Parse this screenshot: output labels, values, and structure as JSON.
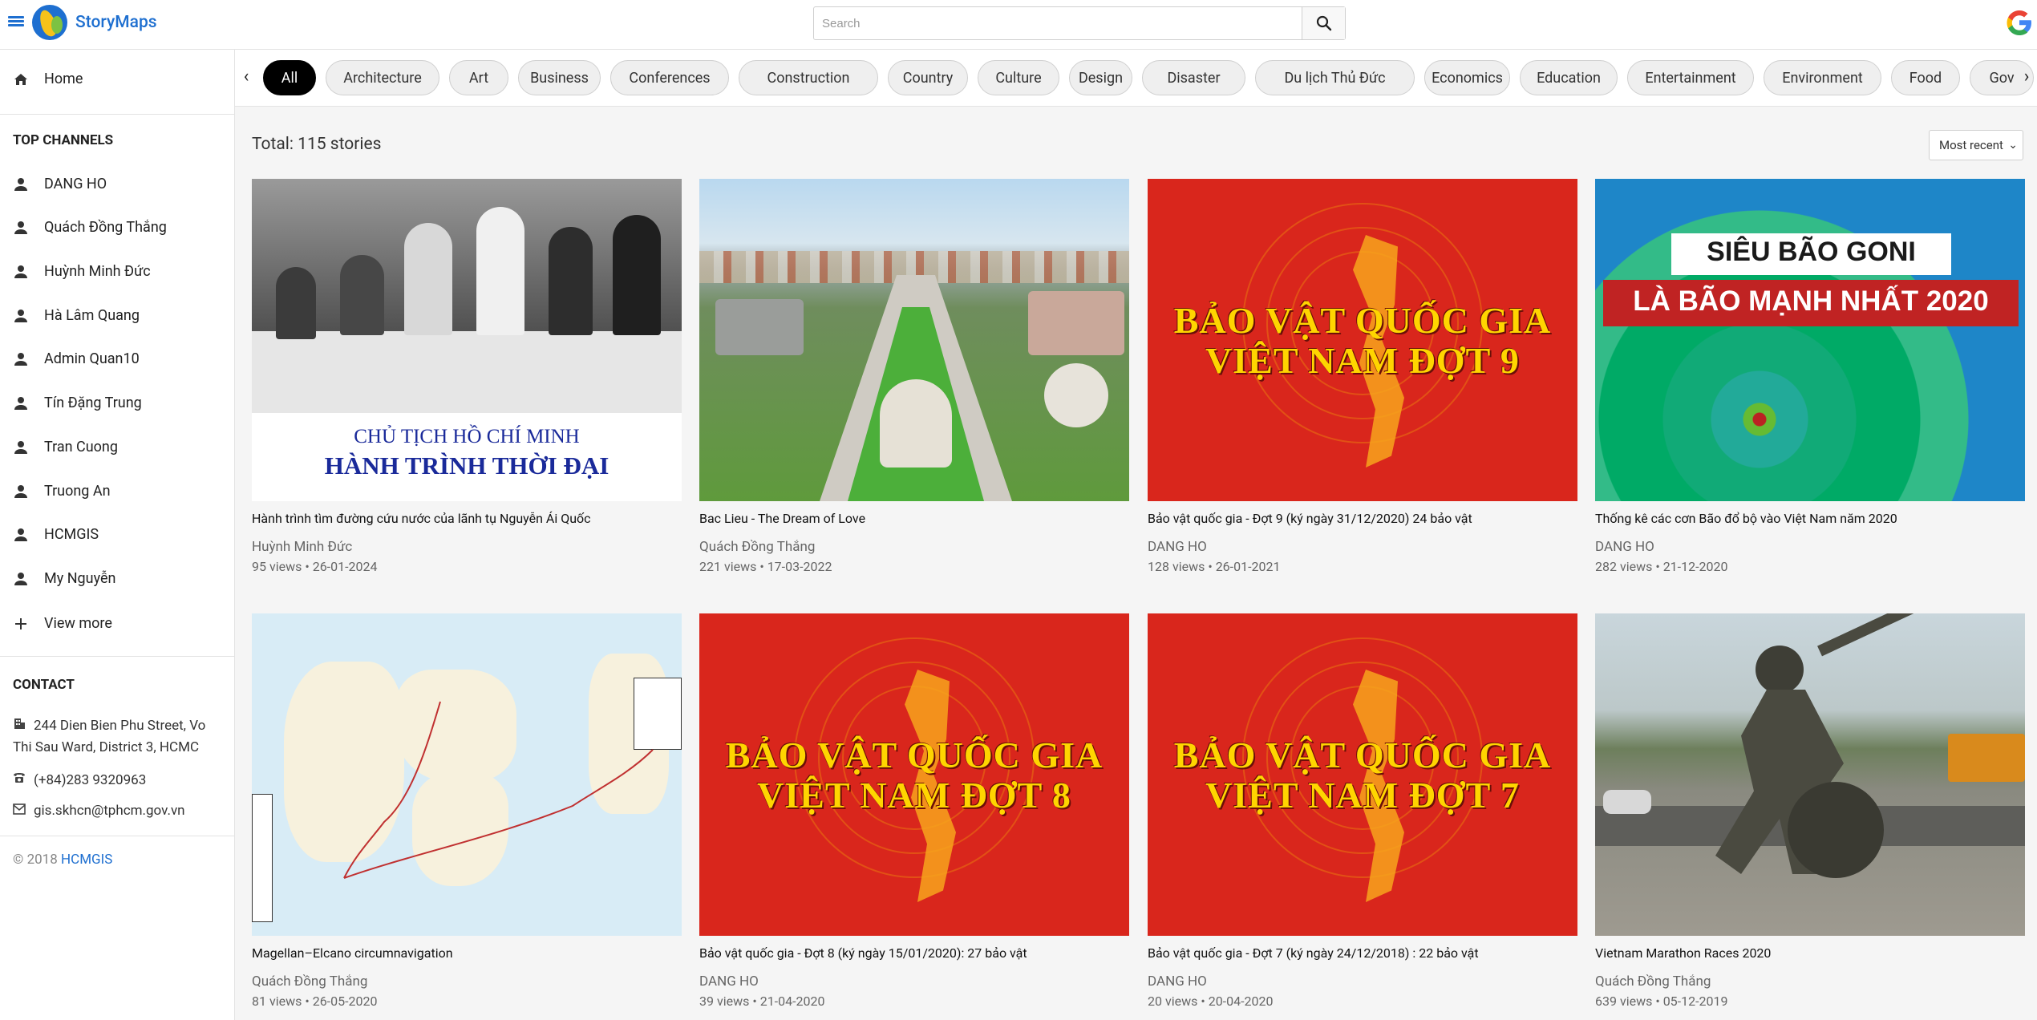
{
  "app": {
    "brand": "StoryMaps"
  },
  "search": {
    "placeholder": "Search"
  },
  "sidebar": {
    "home_label": "Home",
    "top_channels_title": "TOP CHANNELS",
    "channels": [
      "DANG HO",
      "Quách Đồng Thắng",
      "Huỳnh Minh Đức",
      "Hà Lâm Quang",
      "Admin Quan10",
      "Tín Đặng Trung",
      "Tran Cuong",
      "Truong An",
      "HCMGIS",
      "My Nguyễn"
    ],
    "view_more_label": "View more",
    "contact_title": "CONTACT",
    "address": "244 Dien Bien Phu Street, Vo Thi Sau Ward, District 3, HCMC",
    "phone": "(+84)283 9320963",
    "email": "gis.skhcn@tphcm.gov.vn",
    "copyright": "© 2018",
    "copyright_link": "HCMGIS"
  },
  "categories": [
    "All",
    "Architecture",
    "Art",
    "Business",
    "Conferences",
    "Construction",
    "Country",
    "Culture",
    "Design",
    "Disaster",
    "Du lịch Thủ Đức",
    "Economics",
    "Education",
    "Entertainment",
    "Environment",
    "Food",
    "Gov"
  ],
  "main": {
    "total": "Total: 115 stories",
    "sort_selected": "Most recent"
  },
  "stories": [
    {
      "title": "Hành trình tìm đường cứu nước của lãnh tụ Nguyễn Ái Quốc",
      "author": "Huỳnh Minh Đức",
      "meta": "95 views • 26-01-2024",
      "thumb_line1": "CHỦ TỊCH HỒ CHÍ MINH",
      "thumb_line2": "HÀNH TRÌNH THỜI ĐẠI"
    },
    {
      "title": "Bac Lieu - The Dream of Love",
      "author": "Quách Đồng Thắng",
      "meta": "221 views • 17-03-2022"
    },
    {
      "title": "Bảo vật quốc gia - Đợt 9 (ký ngày 31/12/2020) 24 bảo vật",
      "author": "DANG HO",
      "meta": "128 views • 26-01-2021",
      "thumb_line1": "BẢO VẬT QUỐC GIA",
      "thumb_line2": "VIỆT NAM ĐỢT 9"
    },
    {
      "title": "Thống kê các cơn Bão đổ bộ vào Việt Nam năm 2020",
      "author": "DANG HO",
      "meta": "282 views • 21-12-2020",
      "thumb_line1": "SIÊU BÃO GONI",
      "thumb_line2": "LÀ BÃO MẠNH NHẤT 2020"
    },
    {
      "title": "Magellan–Elcano circumnavigation",
      "author": "Quách Đồng Thắng",
      "meta": "81 views • 26-05-2020"
    },
    {
      "title": "Bảo vật quốc gia - Đợt 8 (ký ngày 15/01/2020): 27 bảo vật",
      "author": "DANG HO",
      "meta": "39 views • 21-04-2020",
      "thumb_line1": "BẢO VẬT QUỐC GIA",
      "thumb_line2": "VIỆT NAM ĐỢT 8"
    },
    {
      "title": "Bảo vật quốc gia - Đợt 7 (ký ngày 24/12/2018) : 22 bảo vật",
      "author": "DANG HO",
      "meta": "20 views • 20-04-2020",
      "thumb_line1": "BẢO VẬT QUỐC GIA",
      "thumb_line2": "VIỆT NAM ĐỢT 7"
    },
    {
      "title": "Vietnam Marathon Races 2020",
      "author": "Quách Đồng Thắng",
      "meta": "639 views • 05-12-2019"
    }
  ],
  "colors": {
    "accent": "#1e6fd0",
    "active_chip": "#000000",
    "red_banner": "#d9261c",
    "gold_text": "#ffd500"
  }
}
